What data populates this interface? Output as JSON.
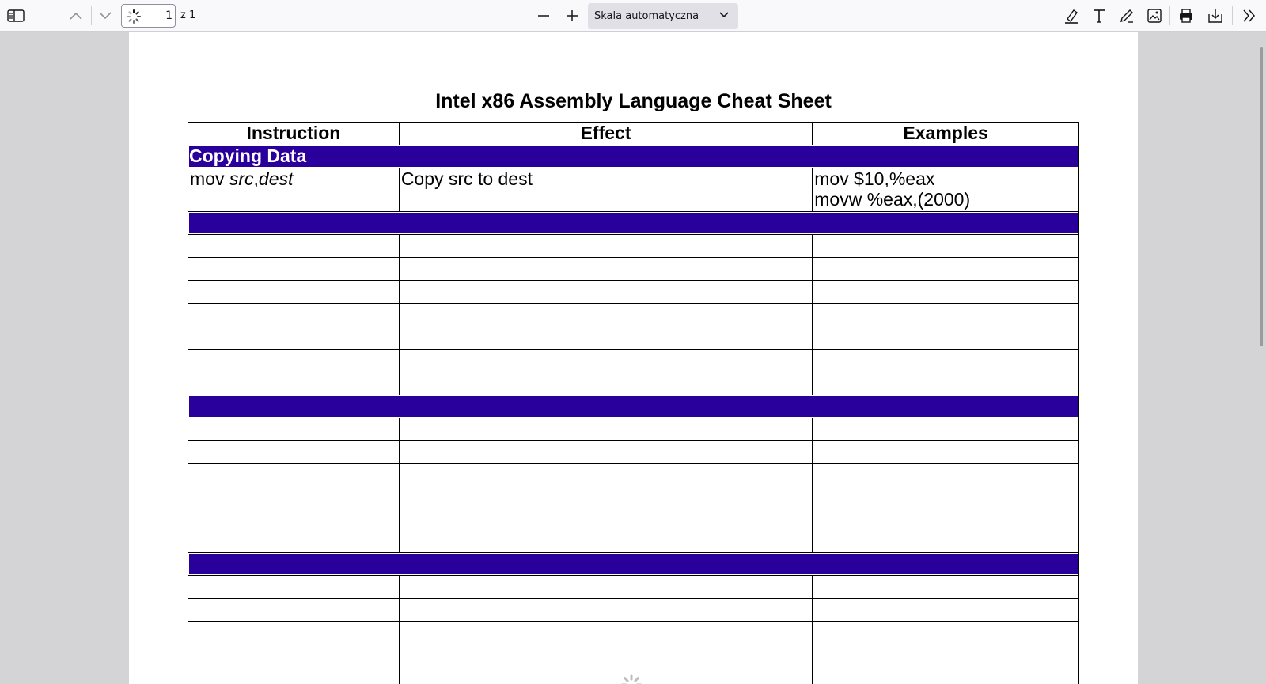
{
  "toolbar": {
    "page_number": "1",
    "page_count": "z 1",
    "zoom_label": "Skala automatyczna"
  },
  "document": {
    "title": "Intel x86 Assembly Language Cheat Sheet",
    "table": {
      "headers": [
        "Instruction",
        "Effect",
        "Examples"
      ],
      "section_1": "Copying Data",
      "row_1": {
        "instr_op": "mov ",
        "instr_src": "src",
        "instr_comma": ",",
        "instr_dest": "dest",
        "effect": "Copy src to dest",
        "example_1": "mov $10,%eax",
        "example_2": "movw %eax,(2000)"
      }
    }
  },
  "colors": {
    "section_bg": "#2a009c",
    "toolbar_bg": "#f9f9fb",
    "viewer_bg": "#d4d4d7"
  }
}
